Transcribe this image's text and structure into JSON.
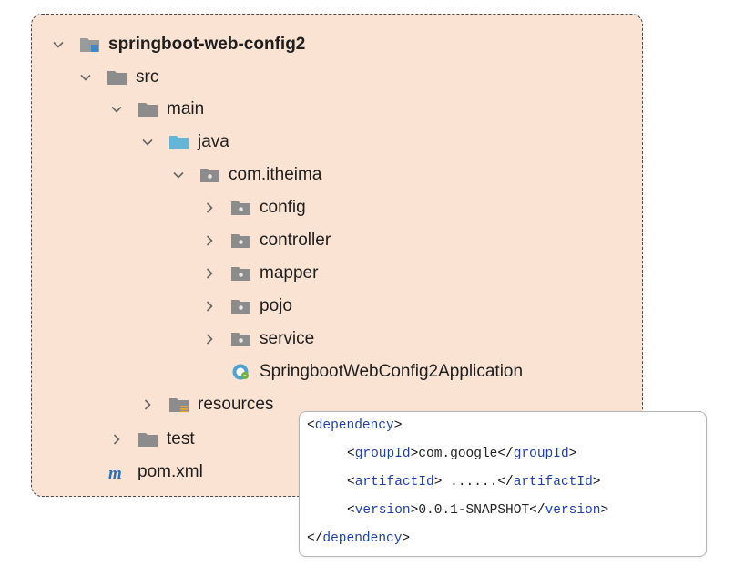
{
  "tree": {
    "project": "springboot-web-config2",
    "src": "src",
    "main": "main",
    "java": "java",
    "package": "com.itheima",
    "packages": [
      "config",
      "controller",
      "mapper",
      "pojo",
      "service"
    ],
    "app_class": "SpringbootWebConfig2Application",
    "resources": "resources",
    "test": "test",
    "pom": "pom.xml"
  },
  "dependency": {
    "open_tag": "dependency",
    "group_tag": "groupId",
    "group_value": "com.google",
    "artifact_tag": "artifactId",
    "artifact_value": " ......",
    "version_tag": "version",
    "version_value": "0.0.1-SNAPSHOT"
  },
  "icons": {
    "chevron": "chevron-icon",
    "folder": "folder-icon",
    "module": "module-folder-icon",
    "source_folder": "source-folder-icon",
    "package": "package-icon",
    "resources_folder": "resources-folder-icon",
    "spring_class": "spring-boot-class-icon",
    "maven": "maven-icon"
  },
  "colors": {
    "panel_bg": "#fbe3d4",
    "folder_gray": "#8c8c8c",
    "java_blue": "#64b5d6",
    "xml_tag": "#1f3fa8"
  }
}
